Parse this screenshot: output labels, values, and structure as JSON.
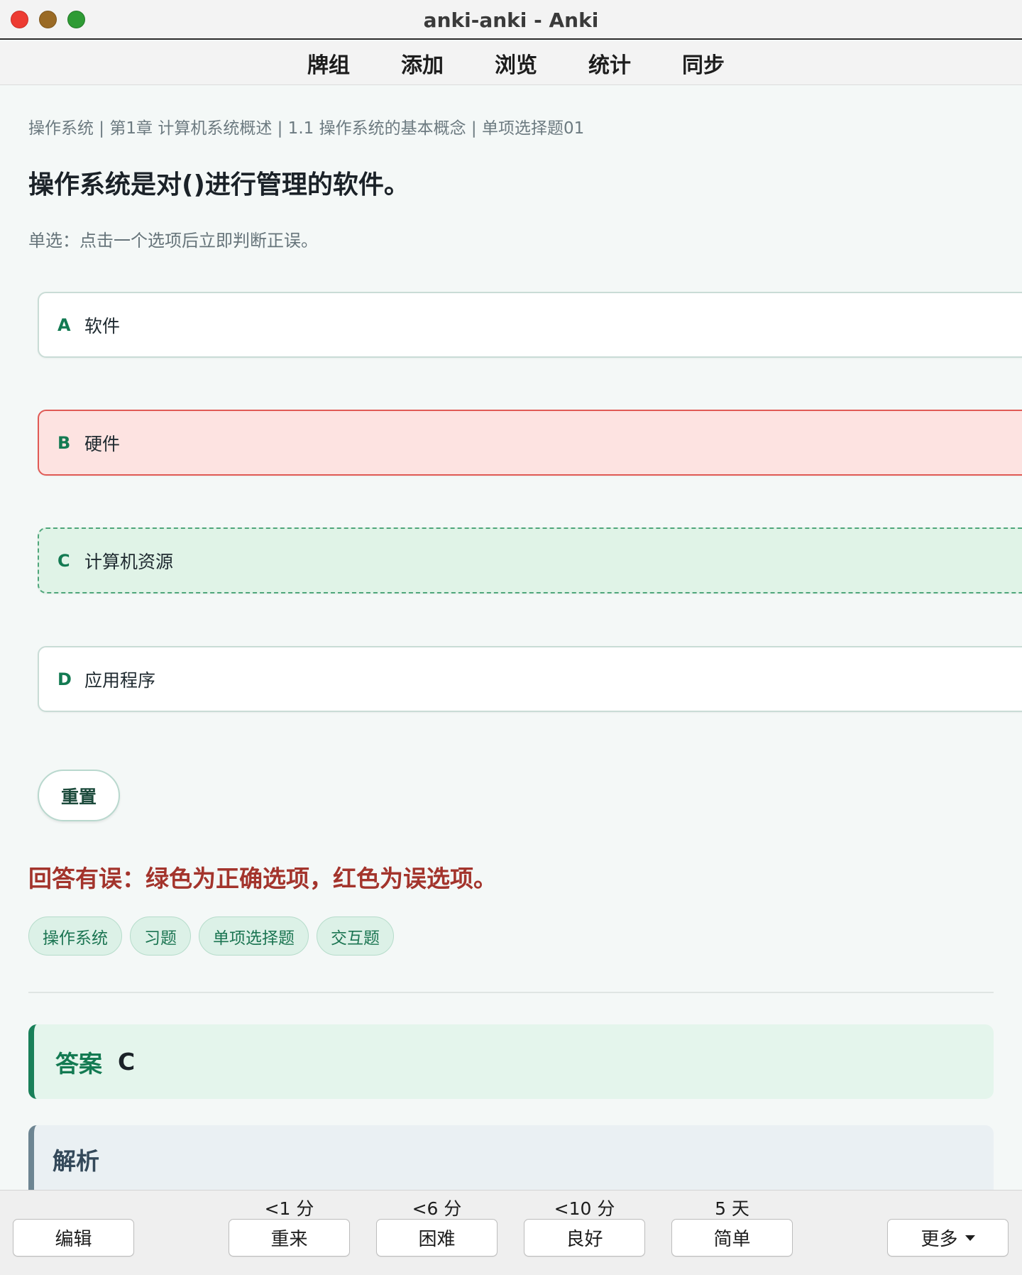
{
  "window": {
    "title": "anki-anki - Anki"
  },
  "nav": {
    "items": [
      "牌组",
      "添加",
      "浏览",
      "统计",
      "同步"
    ]
  },
  "card": {
    "breadcrumb": "操作系统 | 第1章 计算机系统概述 | 1.1 操作系统的基本概念 | 单项选择题01",
    "question": "操作系统是对()进行管理的软件。",
    "hint": "单选：点击一个选项后立即判断正误。",
    "options": [
      {
        "letter": "A",
        "text": "软件",
        "state": "neutral"
      },
      {
        "letter": "B",
        "text": "硬件",
        "state": "wrong-selected"
      },
      {
        "letter": "C",
        "text": "计算机资源",
        "state": "correct"
      },
      {
        "letter": "D",
        "text": "应用程序",
        "state": "neutral"
      }
    ],
    "reset_label": "重置",
    "result_text": "回答有误：绿色为正确选项，红色为误选项。",
    "tags": [
      "操作系统",
      "习题",
      "单项选择题",
      "交互题"
    ],
    "answer_label": "答案",
    "answer_value": "C",
    "explain_label": "解析"
  },
  "bottom": {
    "edit_label": "编辑",
    "intervals": [
      "<1 分",
      "<6 分",
      "<10 分",
      "5 天"
    ],
    "ease_buttons": [
      "重来",
      "困难",
      "良好",
      "简单"
    ],
    "more_label": "更多"
  },
  "colors": {
    "correct": "#137a52",
    "wrong": "#a3342c",
    "wrong_bg": "#fde3e1",
    "correct_bg": "#e0f3e7"
  }
}
